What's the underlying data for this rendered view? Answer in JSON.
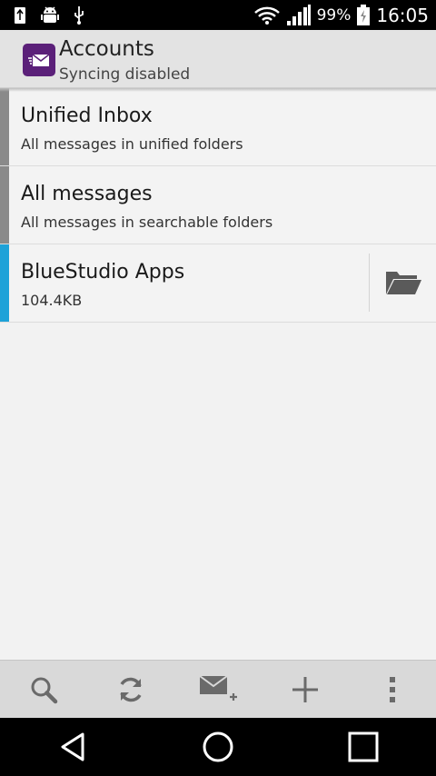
{
  "status_bar": {
    "battery": "99%",
    "time": "16:05",
    "icons": [
      "usb-debug-icon",
      "android-debug-icon",
      "usb-icon",
      "wifi-icon",
      "signal-icon",
      "battery-icon"
    ]
  },
  "header": {
    "title": "Accounts",
    "subtitle": "Syncing disabled",
    "icon": "mail-app-icon",
    "icon_color": "#5b2079"
  },
  "accounts": [
    {
      "title": "Unified Inbox",
      "subtitle": "All messages in unified folders",
      "color": "#8a8a8a",
      "has_folder_button": false
    },
    {
      "title": "All messages",
      "subtitle": "All messages in searchable folders",
      "color": "#8a8a8a",
      "has_folder_button": false
    },
    {
      "title": "BlueStudio Apps",
      "subtitle": "104.4KB",
      "color": "#1ea2d8",
      "has_folder_button": true
    }
  ],
  "toolbar": {
    "buttons": [
      "search-icon",
      "refresh-icon",
      "compose-mail-icon",
      "add-icon",
      "overflow-menu-icon"
    ]
  },
  "nav_bar": {
    "buttons": [
      "back-icon",
      "home-icon",
      "recents-icon"
    ]
  }
}
